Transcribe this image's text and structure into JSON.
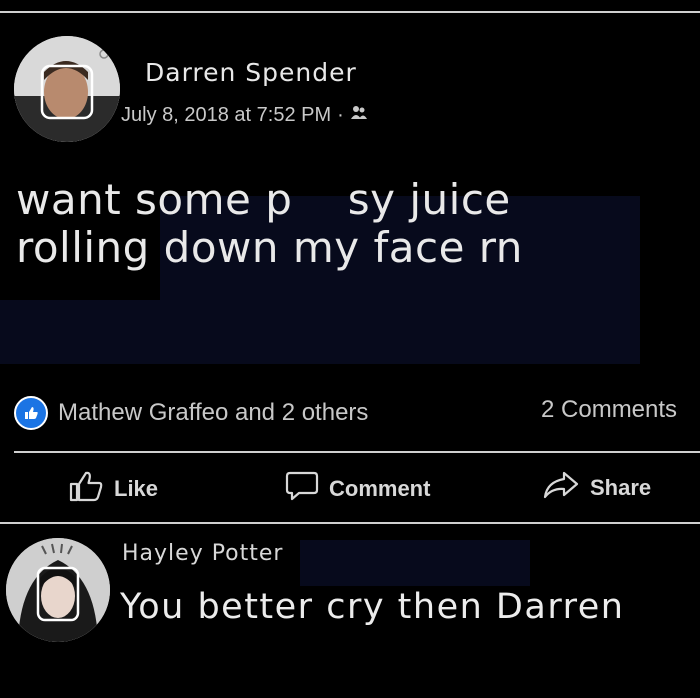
{
  "post": {
    "author": "Darren Spender",
    "timestamp": "July 8, 2018 at 7:52 PM",
    "separator": "·",
    "audience_icon": "friends-icon",
    "text_line1": "want some p    sy juice",
    "text_line2": "rolling down my face rn"
  },
  "reactions": {
    "icon": "like-icon",
    "text": "Mathew Graffeo and 2 others",
    "comments": "2 Comments"
  },
  "actions": {
    "like": "Like",
    "comment": "Comment",
    "share": "Share"
  },
  "comment": {
    "author": "Hayley Potter",
    "text": "You better cry then Darren"
  },
  "colors": {
    "background": "#000000",
    "divider": "#cfcfcf",
    "like_badge": "#1b74e4"
  }
}
